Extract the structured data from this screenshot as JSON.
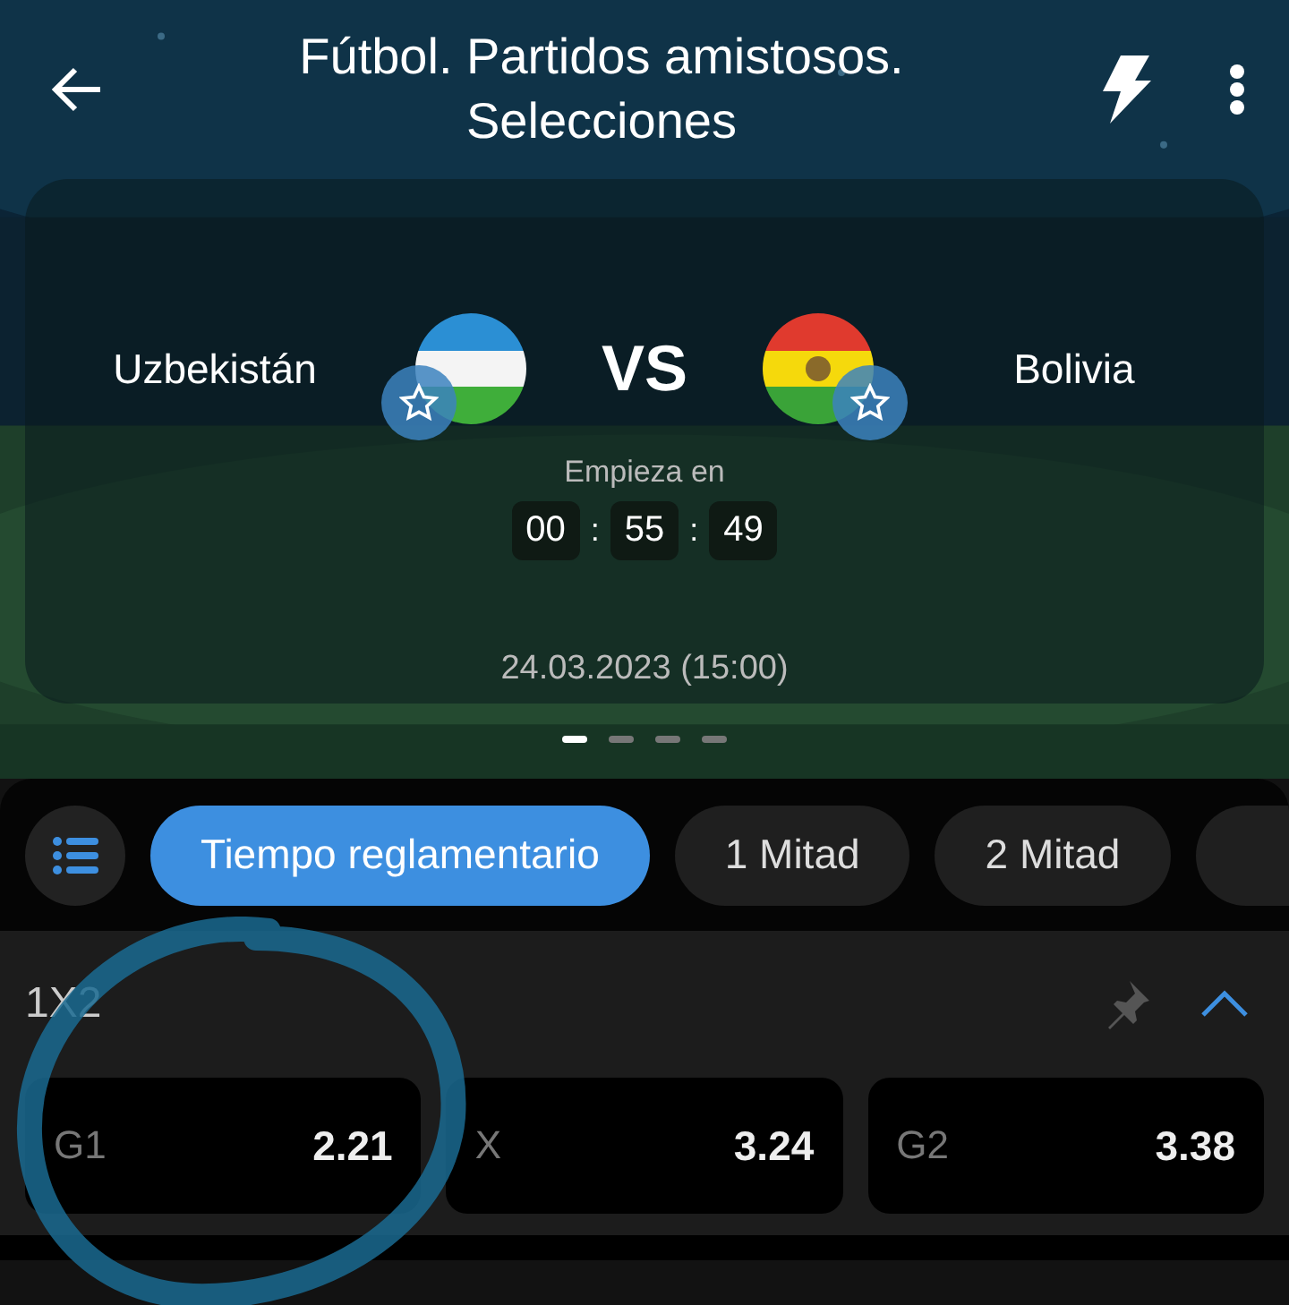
{
  "header": {
    "title": "Fútbol. Partidos amistosos. Selecciones"
  },
  "match": {
    "team_1": "Uzbekistán",
    "vs": "VS",
    "team_2": "Bolivia",
    "starts_label": "Empieza en",
    "countdown": [
      "00",
      "55",
      "49"
    ],
    "separator": ":",
    "date": "24.03.2023 (15:00)"
  },
  "pager": [
    {
      "selected": true
    },
    {
      "selected": false
    },
    {
      "selected": false
    },
    {
      "selected": false
    }
  ],
  "tabs": [
    {
      "label": "Tiempo reglamentario",
      "selected": true
    },
    {
      "label": "1 Mitad",
      "selected": false
    },
    {
      "label": "2 Mitad",
      "selected": false
    }
  ],
  "market": {
    "title": "1X2",
    "expanded": true,
    "odds": [
      {
        "label": "G1",
        "value": "2.21"
      },
      {
        "label": "X",
        "value": "3.24"
      },
      {
        "label": "G2",
        "value": "3.38"
      }
    ]
  }
}
